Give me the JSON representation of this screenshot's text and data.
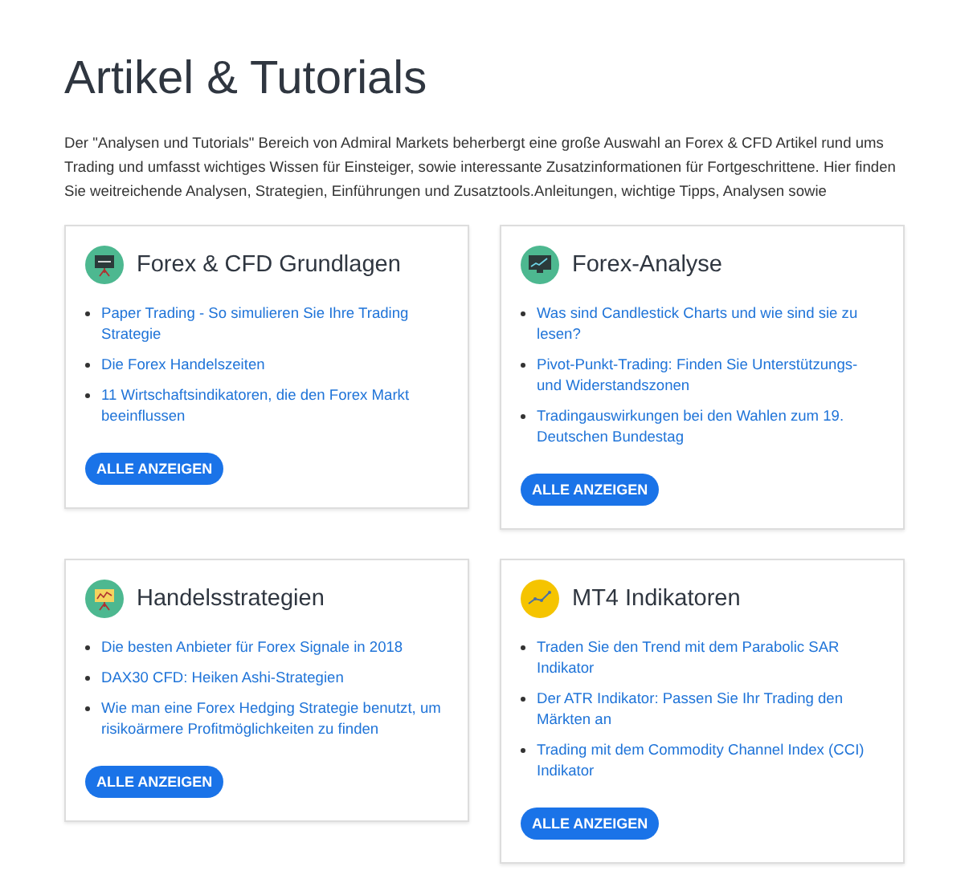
{
  "title": "Artikel & Tutorials",
  "intro": "Der \"Analysen und Tutorials\" Bereich von Admiral Markets beherbergt eine große Auswahl an Forex & CFD Artikel rund ums Trading und umfasst wichtiges Wissen für Einsteiger, sowie interessante Zusatzinformationen für Fortgeschrittene. Hier finden Sie weitreichende Analysen, Strategien, Einführungen und Zusatztools.Anleitungen, wichtige Tipps, Analysen sowie",
  "cards": [
    {
      "kind": "board",
      "title": "Forex & CFD Grundlagen",
      "links": [
        "Paper Trading - So simulieren Sie Ihre Trading Strategie",
        "Die Forex Handelszeiten",
        "11 Wirtschaftsindikatoren, die den Forex Markt beeinflussen"
      ],
      "button": "ALLE ANZEIGEN"
    },
    {
      "kind": "monitor",
      "title": "Forex-Analyse",
      "links": [
        "Was sind Candlestick Charts und wie sind sie zu lesen?",
        "Pivot-Punkt-Trading: Finden Sie Unterstützungs- und Widerstandszonen",
        "Tradingauswirkungen bei den Wahlen zum 19. Deutschen Bundestag"
      ],
      "button": "ALLE ANZEIGEN"
    },
    {
      "kind": "easel",
      "title": "Handelsstrategien",
      "links": [
        "Die besten Anbieter für Forex Signale in 2018",
        "DAX30 CFD: Heiken Ashi-Strategien",
        "Wie man eine Forex Hedging Strategie benutzt, um risikoärmere Profitmöglichkeiten zu finden"
      ],
      "button": "ALLE ANZEIGEN"
    },
    {
      "kind": "graph",
      "title": "MT4 Indikatoren",
      "links": [
        "Traden Sie den Trend mit dem Parabolic SAR Indikator",
        "Der ATR Indikator: Passen Sie Ihr Trading den Märkten an",
        "Trading mit dem Commodity Channel Index (CCI) Indikator"
      ],
      "button": "ALLE ANZEIGEN"
    }
  ]
}
